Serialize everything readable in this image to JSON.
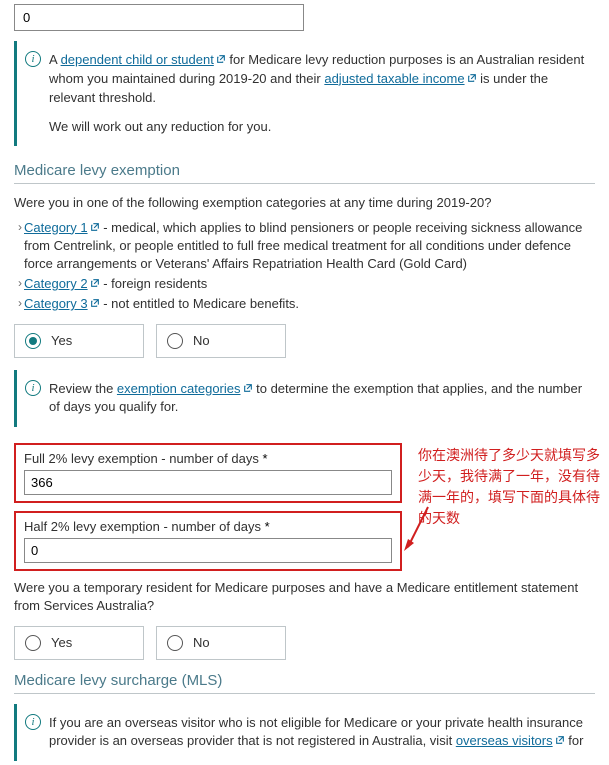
{
  "top_input_value": "0",
  "info1": {
    "p1_a": "A ",
    "link1": "dependent child or student",
    "p1_b": " for Medicare levy reduction purposes is an Australian resident whom you maintained during 2019-20 and their ",
    "link2": "adjusted taxable income",
    "p1_c": " is under the relevant threshold.",
    "p2": "We will work out any reduction for you."
  },
  "section_exemption": "Medicare levy exemption",
  "exemption_q": "Were you in one of the following exemption categories at any time during 2019-20?",
  "cat1": {
    "label": "Category 1",
    "desc": " - medical, which applies to blind pensioners or people receiving sickness allowance from Centrelink, or people entitled to full free medical treatment for all conditions under defence force arrangements or Veterans' Affairs Repatriation Health Card (Gold Card)"
  },
  "cat2": {
    "label": "Category 2",
    "desc": " - foreign residents"
  },
  "cat3": {
    "label": "Category 3",
    "desc": " - not entitled to Medicare benefits."
  },
  "yes": "Yes",
  "no": "No",
  "info2": {
    "a": "Review the ",
    "link": "exemption categories",
    "b": " to determine the exemption that applies, and the number of days you qualify for."
  },
  "full_label": "Full 2% levy exemption - number of days ",
  "full_value": "366",
  "half_label": "Half 2% levy exemption - number of days ",
  "half_value": "0",
  "annotation": "你在澳洲待了多少天就填写多少天，我待满了一年，没有待满一年的，填写下面的具体待的天数",
  "temp_q": "Were you a temporary resident for Medicare purposes and have a Medicare entitlement statement from Services Australia?",
  "section_mls": "Medicare levy surcharge (MLS)",
  "info3": {
    "a": "If you are an overseas visitor who is not eligible for Medicare or your private health insurance provider is an overseas provider that is not registered in Australia, visit ",
    "link": "overseas visitors",
    "b": " for"
  }
}
